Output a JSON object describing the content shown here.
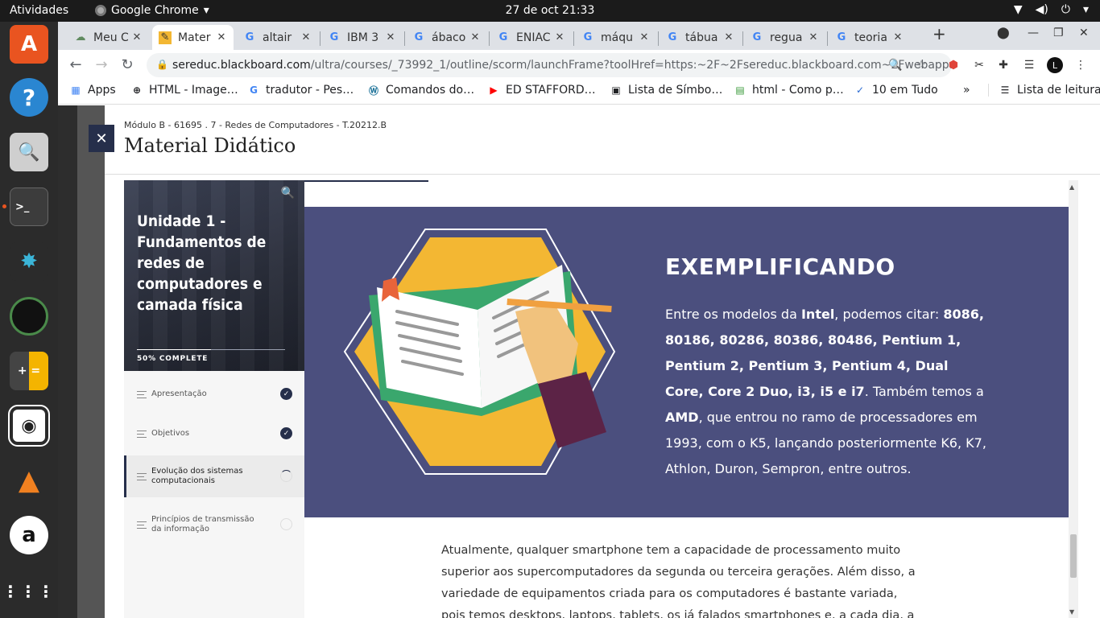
{
  "topbar": {
    "activities": "Atividades",
    "app_name": "Google Chrome",
    "clock": "27 de oct  21:33"
  },
  "dock": {
    "items": [
      "ubuntu-software",
      "help",
      "image-viewer",
      "terminal",
      "mail-client",
      "camera",
      "calculator",
      "screenshot",
      "vlc",
      "amazon",
      "show-apps"
    ]
  },
  "tabs": [
    {
      "title": "Meu C",
      "icon": "cloud-icon",
      "active": false
    },
    {
      "title": "Mater",
      "icon": "note-icon",
      "active": true
    },
    {
      "title": "altair",
      "icon": "google-icon",
      "active": false
    },
    {
      "title": "IBM 3",
      "icon": "google-icon",
      "active": false
    },
    {
      "title": "ábaco",
      "icon": "google-icon",
      "active": false
    },
    {
      "title": "ENIAC",
      "icon": "google-icon",
      "active": false
    },
    {
      "title": "máqu",
      "icon": "google-icon",
      "active": false
    },
    {
      "title": "tábua",
      "icon": "google-icon",
      "active": false
    },
    {
      "title": "regua",
      "icon": "google-icon",
      "active": false
    },
    {
      "title": "teoria",
      "icon": "google-icon",
      "active": false
    }
  ],
  "omnibox": {
    "host": "sereduc.blackboard.com",
    "path": "/ultra/courses/_73992_1/outline/scorm/launchFrame?toolHref=https:~2F~2Fsereduc.blackboard.com~2Fwebapp…"
  },
  "bookmarks": [
    {
      "label": "Apps"
    },
    {
      "label": "HTML - Image…"
    },
    {
      "label": "tradutor - Pes…"
    },
    {
      "label": "Comandos do…"
    },
    {
      "label": "ED STAFFORD…"
    },
    {
      "label": "Lista de Símbo…"
    },
    {
      "label": "html - Como p…"
    },
    {
      "label": "10 em Tudo"
    },
    {
      "label": "Lista de leitura"
    }
  ],
  "panel": {
    "breadcrumb": "Módulo B - 61695 . 7 - Redes de Computadores - T.20212.B",
    "title": "Material Didático"
  },
  "lesson": {
    "title": "Unidade 1 - Fundamentos de redes de computadores e camada física",
    "progress_label": "50% COMPLETE",
    "progress_fraction": 0.5,
    "items": [
      {
        "label": "Apresentação",
        "status": "done"
      },
      {
        "label": "Objetivos",
        "status": "done"
      },
      {
        "label": "Evolução dos sistemas computacionais",
        "status": "in-progress"
      },
      {
        "label": "Princípios de transmissão da informação",
        "status": "empty"
      }
    ]
  },
  "hero": {
    "heading": "EXEMPLIFICANDO",
    "p1": "Entre os modelos da ",
    "b1": "Intel",
    "p2": ", podemos citar: ",
    "b2": "8086, 80186, 80286, 80386, 80486, Pentium 1, Pentium 2, Pentium 3, Pentium 4, Dual Core, Core 2 Duo, i3, i5 e i7",
    "p3": ". Também temos a ",
    "b3": "AMD",
    "p4": ", que entrou no ramo de processadores em 1993, com o K5, lançando posteriormente K6, K7, Athlon, Duron, Sempron, entre outros."
  },
  "body_text": "Atualmente, qualquer smartphone tem a capacidade de processamento muito superior aos supercomputadores da segunda ou terceira gerações. Além disso, a variedade de equipamentos criada para os computadores é bastante variada, pois temos desktops, laptops, tablets, os já falados smartphones e, a cada dia, a evolução tecnológica permite",
  "colors": {
    "hero_bg": "#4b4f7e",
    "accent": "#262f4b",
    "hexagon": "#f3b733"
  }
}
